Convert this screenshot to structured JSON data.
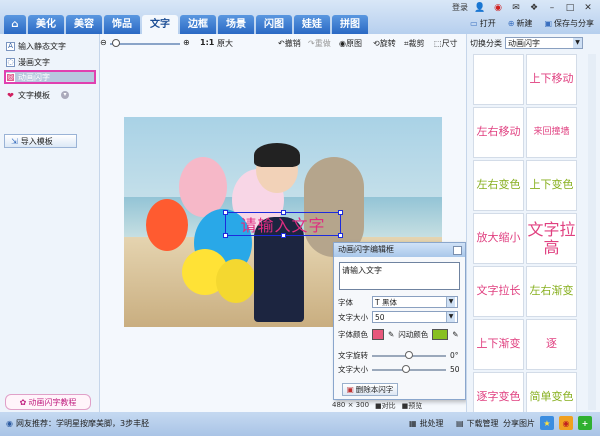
{
  "topbar": {
    "login": "登录"
  },
  "tabs": [
    {
      "label": "美化"
    },
    {
      "label": "美容"
    },
    {
      "label": "饰品"
    },
    {
      "label": "文字"
    },
    {
      "label": "边框"
    },
    {
      "label": "场景"
    },
    {
      "label": "闪图"
    },
    {
      "label": "娃娃"
    },
    {
      "label": "拼图"
    }
  ],
  "file_actions": {
    "open": "打开",
    "new": "新建",
    "save_share": "保存与分享"
  },
  "sidebar": {
    "items": [
      {
        "label": "输入静态文字"
      },
      {
        "label": "漫画文字"
      },
      {
        "label": "动画闪字"
      },
      {
        "label": "文字模板"
      }
    ],
    "import_button": "导入模板",
    "tutorial": "动画闪字教程"
  },
  "edit_toolbar": {
    "zoom_label": "1:1",
    "original_size": "原大",
    "undo": "撤销",
    "redo": "重做",
    "original": "原图",
    "rotate": "旋转",
    "crop": "裁剪",
    "size": "尺寸"
  },
  "canvas": {
    "overlay_text": "请输入文字",
    "image_size": "480 × 300",
    "compare": "对比",
    "preview": "预览"
  },
  "dialog": {
    "title": "动画闪字编辑框",
    "text_value": "请输入文字",
    "font_label": "字体",
    "font_value": "黑体",
    "size_label": "文字大小",
    "size_value": "50",
    "color_label": "字体颜色",
    "flash_color_label": "闪动颜色",
    "rotate_label": "文字旋转",
    "rotate_value": "0°",
    "size2_label": "文字大小",
    "size2_value": "50",
    "delete_button": "删除本闪字",
    "font_color": "#e8587c",
    "flash_color": "#88c020",
    "rotate_fraction": 0.5,
    "size_fraction": 0.46
  },
  "right_panel": {
    "category_label": "切换分类",
    "category_value": "动画闪字",
    "templates": [
      {
        "label": "",
        "color": "#333333"
      },
      {
        "label": "上下移动",
        "color": "#e04080"
      },
      {
        "label": "左右移动",
        "color": "#e04080"
      },
      {
        "label": "来回撞墙",
        "color": "#e04080"
      },
      {
        "label": "左右变色",
        "color": "#88b020"
      },
      {
        "label": "上下变色",
        "color": "#88b020"
      },
      {
        "label": "放大缩小",
        "color": "#e04080"
      },
      {
        "label": "文字拉高",
        "color": "#e04080"
      },
      {
        "label": "文字拉长",
        "color": "#e04080"
      },
      {
        "label": "左右渐变",
        "color": "#88b020"
      },
      {
        "label": "上下渐变",
        "color": "#e04080"
      },
      {
        "label": "逐",
        "color": "#e04080"
      },
      {
        "label": "逐字变色",
        "color": "#e04080"
      },
      {
        "label": "简单变色",
        "color": "#88b020"
      }
    ]
  },
  "bottom": {
    "tip": "网友推荐：学明星按摩美脚，3步丰胫",
    "batch": "批处理",
    "downloads": "下载管理",
    "share": "分享图片"
  }
}
